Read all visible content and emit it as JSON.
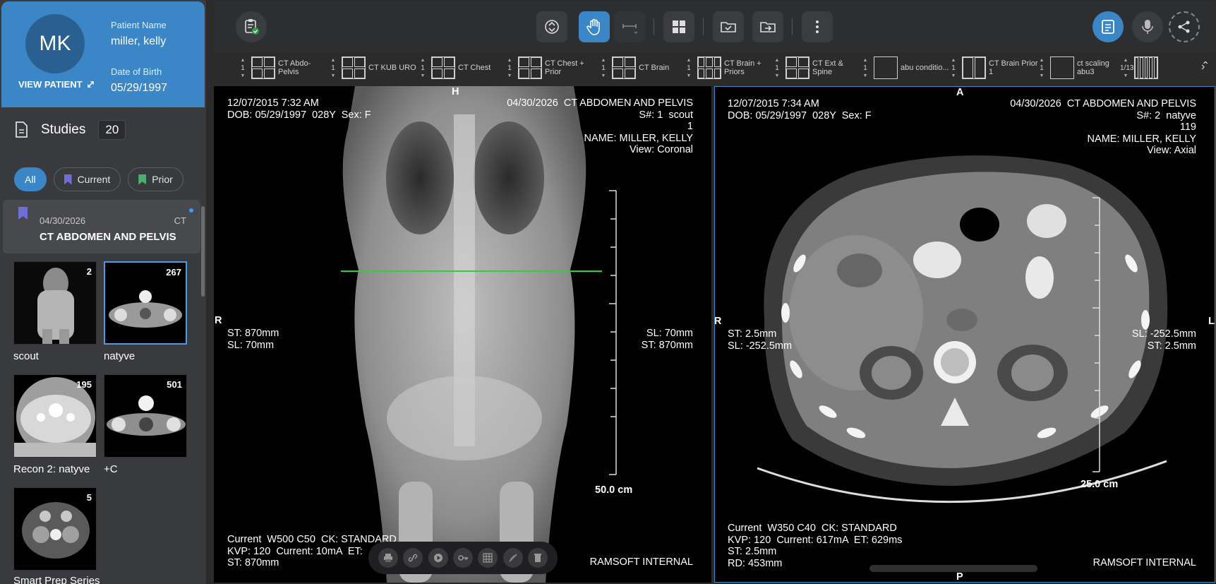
{
  "patient": {
    "initials": "MK",
    "view_patient_label": "VIEW PATIENT",
    "name_label": "Patient Name",
    "name": "miller, kelly",
    "dob_label": "Date of Birth",
    "dob": "05/29/1997"
  },
  "studies": {
    "title": "Studies",
    "count": "20",
    "filters": [
      {
        "label": "All",
        "active": true
      },
      {
        "label": "Current",
        "color": "#6f6fd6"
      },
      {
        "label": "Prior",
        "color": "#4caf72"
      }
    ],
    "item": {
      "date": "04/30/2026",
      "modality": "CT",
      "description": "CT ABDOMEN AND PELVIS"
    },
    "series": [
      {
        "label": "scout",
        "count": "2"
      },
      {
        "label": "natyve",
        "count": "267"
      },
      {
        "label": "Recon 2: natyve",
        "count": "195"
      },
      {
        "label": "+C",
        "count": "501"
      },
      {
        "label": "Smart Prep Series",
        "count": "5"
      }
    ]
  },
  "toolbar": {
    "icons": [
      "clipboard-check-icon",
      "scroll-icon",
      "pan-hand-icon",
      "ruler-icon",
      "layout-grid-icon",
      "folder-check-icon",
      "folder-export-icon",
      "more-icon",
      "report-icon",
      "microphone-icon",
      "share-icon"
    ]
  },
  "layouts": [
    {
      "num": "1",
      "name": "CT Abdo-Pelvis",
      "grid": 4
    },
    {
      "num": "1",
      "name": "CT KUB URO",
      "grid": 4
    },
    {
      "num": "1",
      "name": "CT Chest",
      "grid": 4
    },
    {
      "num": "1",
      "name": "CT Chest + Prior",
      "grid": 4
    },
    {
      "num": "1",
      "name": "CT Brain",
      "grid": 4
    },
    {
      "num": "1",
      "name": "CT Brain + Priors",
      "grid": 6
    },
    {
      "num": "1",
      "name": "CT Ext & Spine",
      "grid": 4
    },
    {
      "num": "1",
      "name": "abu conditio...",
      "grid": 1
    },
    {
      "num": "1",
      "name": "CT Brain Prior 1",
      "grid": 2
    },
    {
      "num": "1",
      "name": "ct scaling abu3",
      "grid": 1
    },
    {
      "num": "1/13",
      "name": "",
      "grid": 5
    }
  ],
  "viewport_left": {
    "tl": "12/07/2015 7:32 AM\nDOB: 05/29/1997  028Y  Sex: F",
    "tr": "04/30/2026  CT ABDOMEN AND PELVIS\nS#: 1  scout\n1\nNAME: MILLER, KELLY\nView: Coronal",
    "ml": "ST: 870mm\nSL: 70mm",
    "mr": "SL: 70mm\nST: 870mm",
    "bl": "Current  W500 C50  CK: STANDARD\nKVP: 120  Current: 10mA  ET:\nST: 870mm",
    "br": "RAMSOFT INTERNAL",
    "scale": "50.0 cm",
    "orient_left": "R",
    "orient_top": "H"
  },
  "viewport_right": {
    "tl": "12/07/2015 7:34 AM\nDOB: 05/29/1997  028Y  Sex: F",
    "tr": "04/30/2026  CT ABDOMEN AND PELVIS\nS#: 2  natyve\n119\nNAME: MILLER, KELLY\nView: Axial",
    "ml": "ST: 2.5mm\nSL: -252.5mm",
    "mr": "SL: -252.5mm\nST: 2.5mm",
    "bl": "Current  W350 C40  CK: STANDARD\nKVP: 120  Current: 617mA  ET: 629ms\nST: 2.5mm\nRD: 453mm",
    "br": "RAMSOFT INTERNAL",
    "scale": "25.0 cm",
    "orient_left": "LR",
    "orient_top": "A",
    "orient_right": "L",
    "orient_bottom": "P"
  },
  "colors": {
    "accent": "#3b86c6",
    "sidebar": "#393a3d",
    "crosshair": "#2fd12f"
  }
}
